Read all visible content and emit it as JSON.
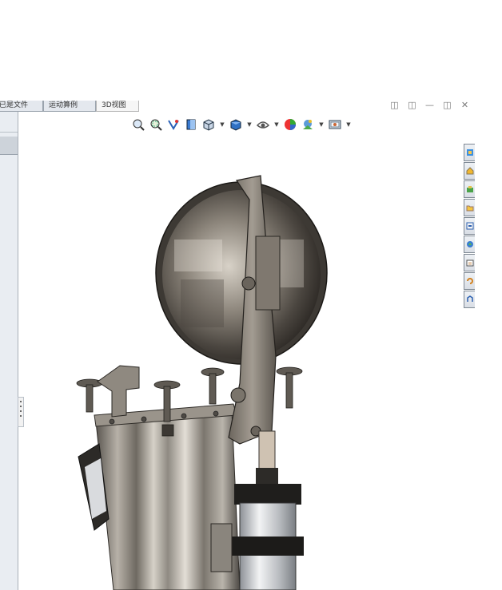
{
  "tabs": [
    {
      "label": "已是文件",
      "active": false
    },
    {
      "label": "运动算例",
      "active": false
    },
    {
      "label": "3D视图",
      "active": true
    }
  ],
  "window_controls": [
    "restore-icon",
    "tile-icon",
    "minimize-icon",
    "maximize-icon",
    "close-icon"
  ],
  "hud_toolbar": [
    {
      "icon": "zoom-to-fit-icon",
      "dropdown": false
    },
    {
      "icon": "zoom-to-area-icon",
      "dropdown": false
    },
    {
      "icon": "previous-view-icon",
      "dropdown": false
    },
    {
      "icon": "section-view-icon",
      "dropdown": false
    },
    {
      "icon": "view-orientation-icon",
      "dropdown": true
    },
    {
      "icon": "display-style-icon",
      "dropdown": true
    },
    {
      "icon": "hide-show-items-icon",
      "dropdown": true
    },
    {
      "icon": "edit-appearance-icon",
      "dropdown": false
    },
    {
      "icon": "apply-scene-icon",
      "dropdown": true
    },
    {
      "icon": "view-settings-icon",
      "dropdown": true
    }
  ],
  "task_pane": [
    "solidworks-resources-icon",
    "design-library-icon",
    "file-explorer-icon",
    "view-palette-icon",
    "appearances-icon",
    "custom-properties-icon",
    "toolbox-icon",
    "document-recovery-icon",
    "forum-icon"
  ],
  "colors": {
    "panel_bg": "#e9edf2",
    "viewport_bg": "#ffffff",
    "metal": "#8e8a84",
    "steel": "#c9ccd0"
  }
}
